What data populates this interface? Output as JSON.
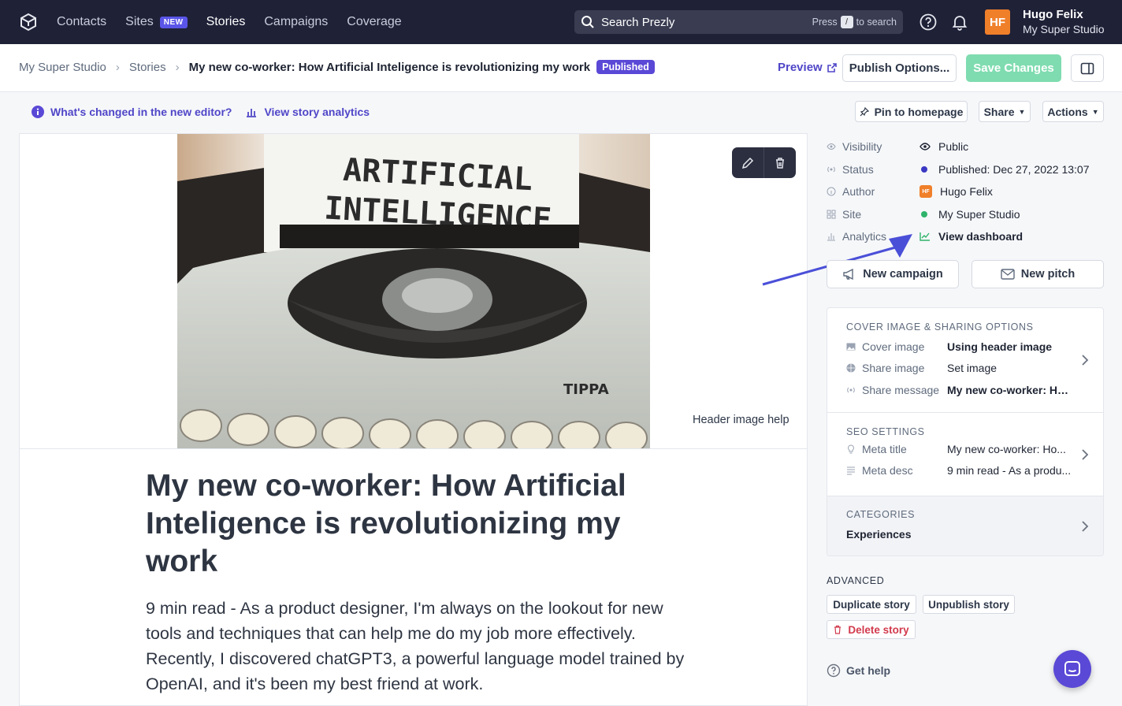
{
  "topnav": {
    "items": [
      {
        "label": "Contacts"
      },
      {
        "label": "Sites",
        "badge": "NEW"
      },
      {
        "label": "Stories"
      },
      {
        "label": "Campaigns"
      },
      {
        "label": "Coverage"
      }
    ],
    "search": {
      "placeholder": "Search Prezly",
      "hint_press": "Press",
      "hint_key": "/",
      "hint_to": "to search"
    },
    "user": {
      "initials": "HF",
      "name": "Hugo Felix",
      "site": "My Super Studio"
    }
  },
  "header": {
    "breadcrumb": [
      "My Super Studio",
      "Stories"
    ],
    "story_title": "My new co-worker: How Artificial Inteligence is revolutionizing my work",
    "status_badge": "Published",
    "preview_label": "Preview",
    "publish_options_label": "Publish Options...",
    "save_label": "Save Changes"
  },
  "toolbar": {
    "whats_changed": "What's changed in the new editor?",
    "view_analytics": "View story analytics",
    "pin_label": "Pin to homepage",
    "share_label": "Share",
    "actions_label": "Actions"
  },
  "editor": {
    "image_text_line1": "ARTIFICIAL",
    "image_text_line2": "INTELLIGENCE",
    "image_brand": "TIPPA",
    "header_image_help": "Header image help",
    "title": "My new co-worker: How Artificial Inteligence is revolutionizing my work",
    "lead": "9 min read - As a product designer, I'm always on the lookout for new tools and techniques that can help me do my job more effectively. Recently, I discovered chatGPT3, a powerful language model trained by OpenAI, and it's been my best friend at work."
  },
  "sidebar": {
    "meta": [
      {
        "key": "Visibility",
        "value": "Public",
        "color": "#1e2433"
      },
      {
        "key": "Status",
        "value": "Published: Dec 27, 2022 13:07",
        "color": "#4f46c8"
      },
      {
        "key": "Author",
        "value": "Hugo Felix",
        "avatar": "HF"
      },
      {
        "key": "Site",
        "value": "My Super Studio",
        "color": "#2fb36b"
      },
      {
        "key": "Analytics",
        "value": "View dashboard"
      }
    ],
    "new_campaign": "New campaign",
    "new_pitch": "New pitch",
    "cover": {
      "heading": "COVER IMAGE & SHARING OPTIONS",
      "rows": [
        {
          "key": "Cover image",
          "value": "Using header image"
        },
        {
          "key": "Share image",
          "value": "Set image"
        },
        {
          "key": "Share message",
          "value": "My new co-worker: Ho..."
        }
      ]
    },
    "seo": {
      "heading": "SEO SETTINGS",
      "rows": [
        {
          "key": "Meta title",
          "value": "My new co-worker: Ho..."
        },
        {
          "key": "Meta desc",
          "value": "9 min read - As a produ..."
        }
      ]
    },
    "categories": {
      "heading": "CATEGORIES",
      "value": "Experiences"
    },
    "advanced": {
      "heading": "ADVANCED",
      "duplicate": "Duplicate story",
      "unpublish": "Unpublish story",
      "delete": "Delete story"
    },
    "get_help": "Get help"
  }
}
